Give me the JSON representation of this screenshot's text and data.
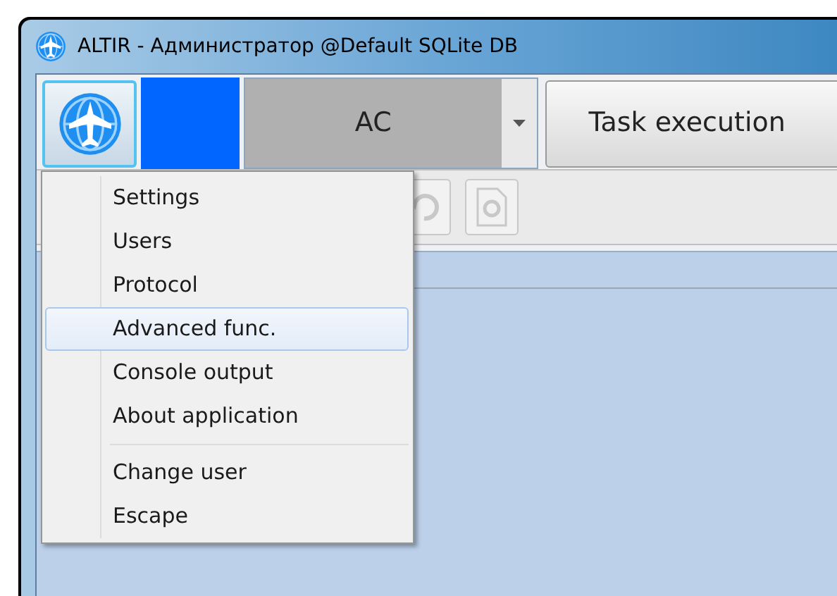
{
  "window": {
    "title": "ALTIR - Администратор @Default SQLite DB"
  },
  "toolbar": {
    "dropdown": {
      "value": "AC"
    },
    "task_button": {
      "label": "Task execution"
    }
  },
  "app_menu": {
    "groups": [
      [
        {
          "label": "Settings",
          "selected": false
        },
        {
          "label": "Users",
          "selected": false
        },
        {
          "label": "Protocol",
          "selected": false
        },
        {
          "label": "Advanced func.",
          "selected": true
        },
        {
          "label": "Console output",
          "selected": false
        },
        {
          "label": "About application",
          "selected": false
        }
      ],
      [
        {
          "label": "Change user",
          "selected": false
        },
        {
          "label": "Escape",
          "selected": false
        }
      ]
    ]
  }
}
